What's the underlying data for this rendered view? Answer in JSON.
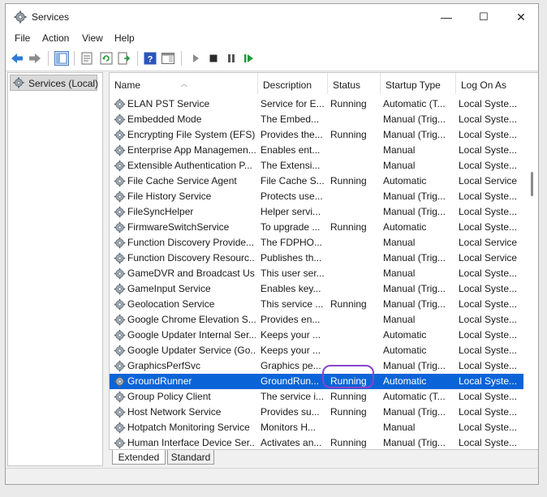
{
  "window": {
    "title": "Services",
    "controls": {
      "minimize": "—",
      "maximize": "☐",
      "close": "✕"
    }
  },
  "menu": [
    "File",
    "Action",
    "View",
    "Help"
  ],
  "tree": {
    "root": "Services (Local)"
  },
  "columns": [
    "Name",
    "Description",
    "Status",
    "Startup Type",
    "Log On As"
  ],
  "rows": [
    {
      "name": "ELAN PST Service",
      "description": "Service for E...",
      "status": "Running",
      "startup": "Automatic (T...",
      "logon": "Local Syste..."
    },
    {
      "name": "Embedded Mode",
      "description": "The Embed...",
      "status": "",
      "startup": "Manual (Trig...",
      "logon": "Local Syste..."
    },
    {
      "name": "Encrypting File System (EFS)",
      "description": "Provides the...",
      "status": "Running",
      "startup": "Manual (Trig...",
      "logon": "Local Syste..."
    },
    {
      "name": "Enterprise App Managemen...",
      "description": "Enables ent...",
      "status": "",
      "startup": "Manual",
      "logon": "Local Syste..."
    },
    {
      "name": "Extensible Authentication P...",
      "description": "The Extensi...",
      "status": "",
      "startup": "Manual",
      "logon": "Local Syste..."
    },
    {
      "name": "File Cache Service Agent",
      "description": "File Cache S...",
      "status": "Running",
      "startup": "Automatic",
      "logon": "Local Service"
    },
    {
      "name": "File History Service",
      "description": "Protects use...",
      "status": "",
      "startup": "Manual (Trig...",
      "logon": "Local Syste..."
    },
    {
      "name": "FileSyncHelper",
      "description": "Helper servi...",
      "status": "",
      "startup": "Manual (Trig...",
      "logon": "Local Syste..."
    },
    {
      "name": "FirmwareSwitchService",
      "description": "To upgrade ...",
      "status": "Running",
      "startup": "Automatic",
      "logon": "Local Syste..."
    },
    {
      "name": "Function Discovery Provide...",
      "description": "The FDPHO...",
      "status": "",
      "startup": "Manual",
      "logon": "Local Service"
    },
    {
      "name": "Function Discovery Resourc...",
      "description": "Publishes th...",
      "status": "",
      "startup": "Manual (Trig...",
      "logon": "Local Service"
    },
    {
      "name": "GameDVR and Broadcast Us...",
      "description": "This user ser...",
      "status": "",
      "startup": "Manual",
      "logon": "Local Syste..."
    },
    {
      "name": "GameInput Service",
      "description": "Enables key...",
      "status": "",
      "startup": "Manual (Trig...",
      "logon": "Local Syste..."
    },
    {
      "name": "Geolocation Service",
      "description": "This service ...",
      "status": "Running",
      "startup": "Manual (Trig...",
      "logon": "Local Syste..."
    },
    {
      "name": "Google Chrome Elevation S...",
      "description": "Provides en...",
      "status": "",
      "startup": "Manual",
      "logon": "Local Syste..."
    },
    {
      "name": "Google Updater Internal Ser...",
      "description": "Keeps your ...",
      "status": "",
      "startup": "Automatic",
      "logon": "Local Syste..."
    },
    {
      "name": "Google Updater Service (Go...",
      "description": "Keeps your ...",
      "status": "",
      "startup": "Automatic",
      "logon": "Local Syste..."
    },
    {
      "name": "GraphicsPerfSvc",
      "description": "Graphics pe...",
      "status": "",
      "startup": "Manual (Trig...",
      "logon": "Local Syste..."
    },
    {
      "name": "GroundRunner",
      "description": "GroundRun...",
      "status": "Running",
      "startup": "Automatic",
      "logon": "Local Syste...",
      "selected": true
    },
    {
      "name": "Group Policy Client",
      "description": "The service i...",
      "status": "Running",
      "startup": "Automatic (T...",
      "logon": "Local Syste..."
    },
    {
      "name": "Host Network Service",
      "description": "Provides su...",
      "status": "Running",
      "startup": "Manual (Trig...",
      "logon": "Local Syste..."
    },
    {
      "name": "Hotpatch Monitoring Service",
      "description": "Monitors H...",
      "status": "",
      "startup": "Manual",
      "logon": "Local Syste..."
    },
    {
      "name": "Human Interface Device Ser...",
      "description": "Activates an...",
      "status": "Running",
      "startup": "Manual (Trig...",
      "logon": "Local Syste..."
    }
  ],
  "tabs": [
    "Extended",
    "Standard"
  ],
  "colors": {
    "selection": "#0a64d8",
    "highlight_ring": "#8a44c9"
  }
}
